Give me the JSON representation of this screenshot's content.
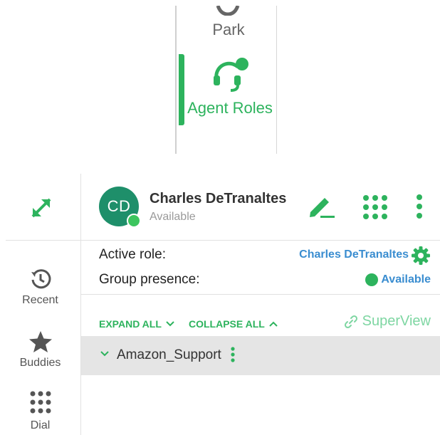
{
  "top_nav": {
    "park_label": "Park",
    "agent_roles_label": "Agent Roles"
  },
  "left_nav": {
    "items": [
      {
        "label": "Recent",
        "icon": "history-icon"
      },
      {
        "label": "Buddies",
        "icon": "star-icon"
      },
      {
        "label": "Dial",
        "icon": "dialpad-icon"
      }
    ]
  },
  "user": {
    "initials": "CD",
    "name": "Charles DeTranaltes",
    "status": "Available"
  },
  "role": {
    "active_role_label": "Active role:",
    "active_role_value": "Charles DeTranaltes",
    "group_presence_label": "Group presence:",
    "group_presence_value": "Available"
  },
  "controls": {
    "expand_all": "EXPAND ALL",
    "collapse_all": "COLLAPSE ALL",
    "superview": "SuperView"
  },
  "groups": [
    {
      "name": "Amazon_Support"
    }
  ],
  "colors": {
    "accent_green": "#2db35d",
    "link_blue": "#3a8dd0",
    "avatar_teal": "#1e8f6a"
  }
}
